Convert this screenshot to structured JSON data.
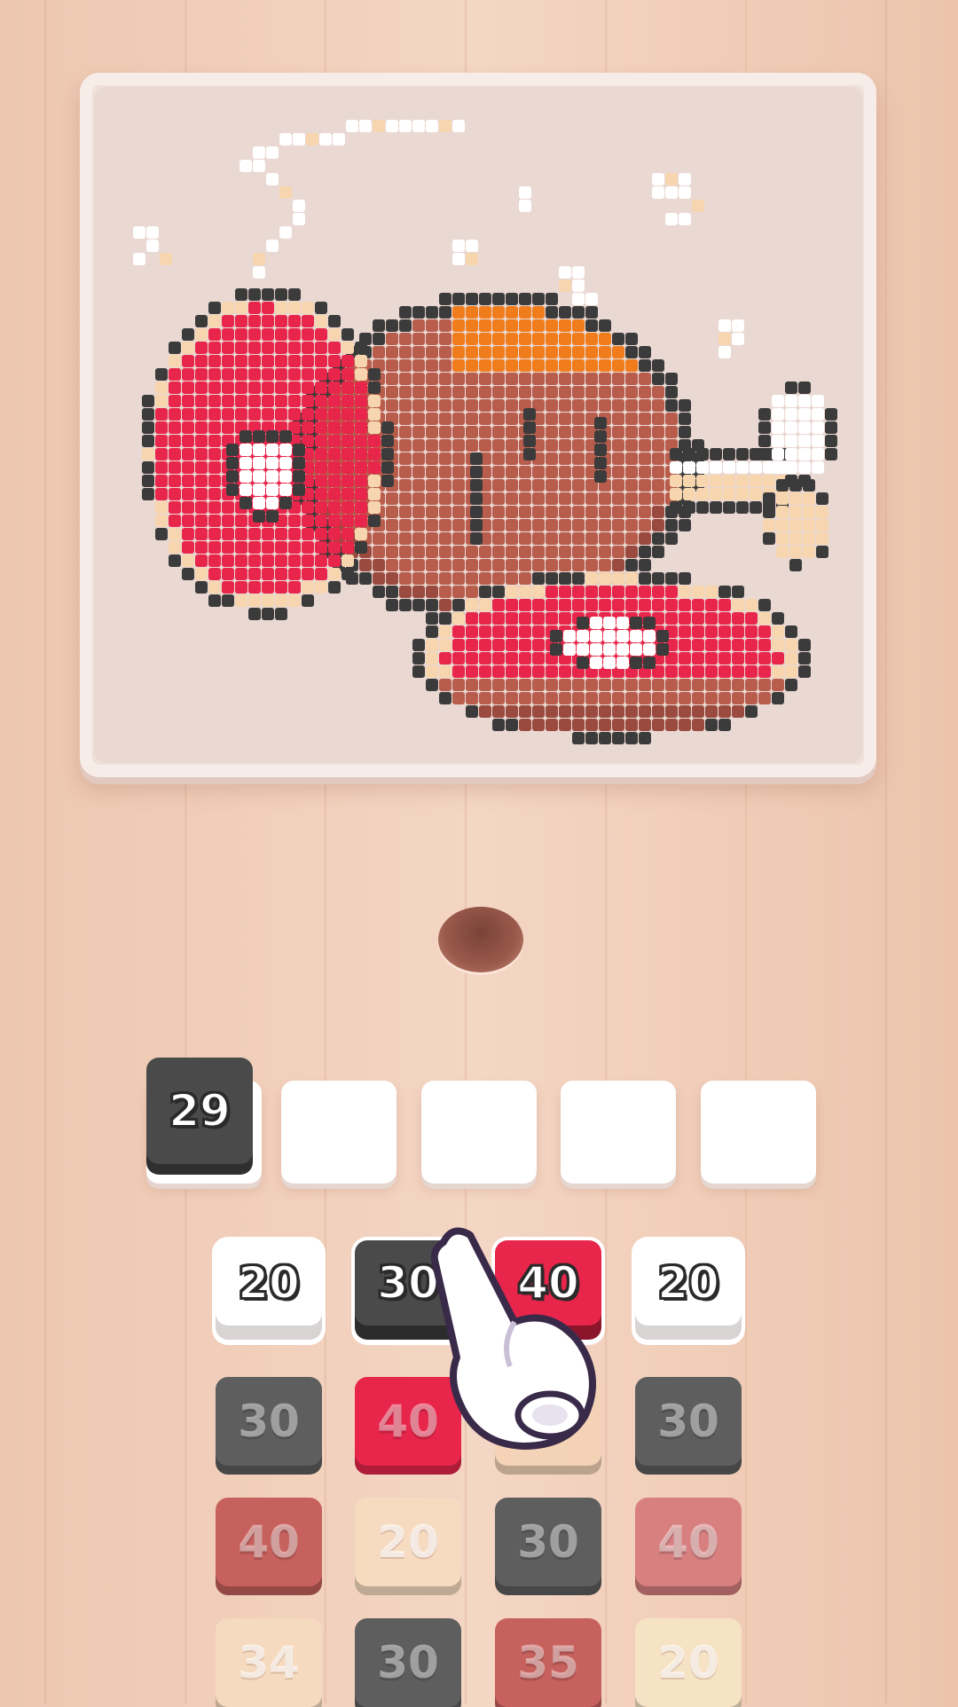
{
  "picture": {
    "subject": "pixel-art ham with bone and steak slice",
    "palette": {
      "outline": "#3b3b3b",
      "red": "#e8254a",
      "brown": "#b85c4c",
      "dark_brown": "#9a4a3e",
      "orange": "#f07c1c",
      "cream": "#f7d5ae",
      "white": "#ffffff"
    }
  },
  "collector_slots": [
    {
      "value": "29",
      "color": "#4a4a4a"
    },
    {
      "value": "",
      "color": "#ffffff"
    },
    {
      "value": "",
      "color": "#ffffff"
    },
    {
      "value": "",
      "color": "#ffffff"
    },
    {
      "value": "",
      "color": "#ffffff"
    }
  ],
  "tile_rows": [
    [
      {
        "value": "20",
        "color": "#ffffff",
        "state": "active"
      },
      {
        "value": "30",
        "color": "#4a4a4a",
        "state": "active"
      },
      {
        "value": "40",
        "color": "#e8254a",
        "state": "active"
      },
      {
        "value": "20",
        "color": "#ffffff",
        "state": "active"
      }
    ],
    [
      {
        "value": "30",
        "color": "#5e5e5e",
        "state": "dim"
      },
      {
        "value": "40",
        "color": "#e8254a",
        "state": "dim"
      },
      {
        "value": "",
        "color": "#f4d3b6",
        "state": "dim"
      },
      {
        "value": "30",
        "color": "#5e5e5e",
        "state": "dim"
      }
    ],
    [
      {
        "value": "40",
        "color": "#c7615d",
        "state": "dim"
      },
      {
        "value": "20",
        "color": "#f7dcc0",
        "state": "dim"
      },
      {
        "value": "30",
        "color": "#5e5e5e",
        "state": "dim"
      },
      {
        "value": "40",
        "color": "#d88080",
        "state": "dim"
      }
    ],
    [
      {
        "value": "34",
        "color": "#f7dcc0",
        "state": "dim"
      },
      {
        "value": "30",
        "color": "#5e5e5e",
        "state": "dim"
      },
      {
        "value": "35",
        "color": "#c7615d",
        "state": "dim"
      },
      {
        "value": "20",
        "color": "#f7e6c6",
        "state": "dim"
      }
    ]
  ],
  "tutorial_pointer": {
    "icon": "pointing-hand-icon"
  }
}
